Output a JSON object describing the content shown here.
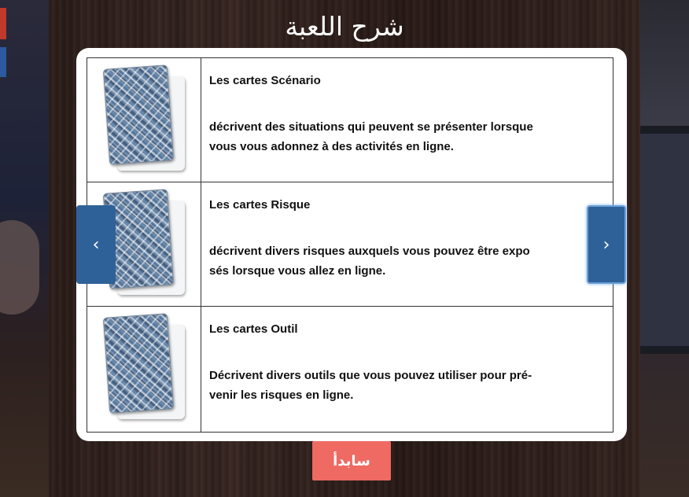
{
  "title": "شرح اللعبة",
  "cards": [
    {
      "title": "Les cartes Scénario",
      "line1": "décrivent des situations qui peuvent se présenter lorsque",
      "line2": "vous vous adonnez à des activités en ligne."
    },
    {
      "title": "Les cartes Risque",
      "line1": "décrivent divers risques auxquels vous pouvez être expo",
      "line2": "sés lorsque vous allez en ligne."
    },
    {
      "title": "Les cartes Outil",
      "line1": "Décrivent divers outils que vous pouvez utiliser pour pré-",
      "line2": "venir les risques en ligne."
    }
  ],
  "nav": {
    "prev_icon": "‹",
    "next_icon": "›"
  },
  "start_button": {
    "label": "سابدأ"
  },
  "colors": {
    "nav_button": "#2f6199",
    "start_button": "#ee6a63",
    "panel": "#ffffff"
  },
  "icons": {
    "prev": "chevron-left-icon",
    "next": "chevron-right-icon",
    "card_back": "card-back-icon"
  }
}
